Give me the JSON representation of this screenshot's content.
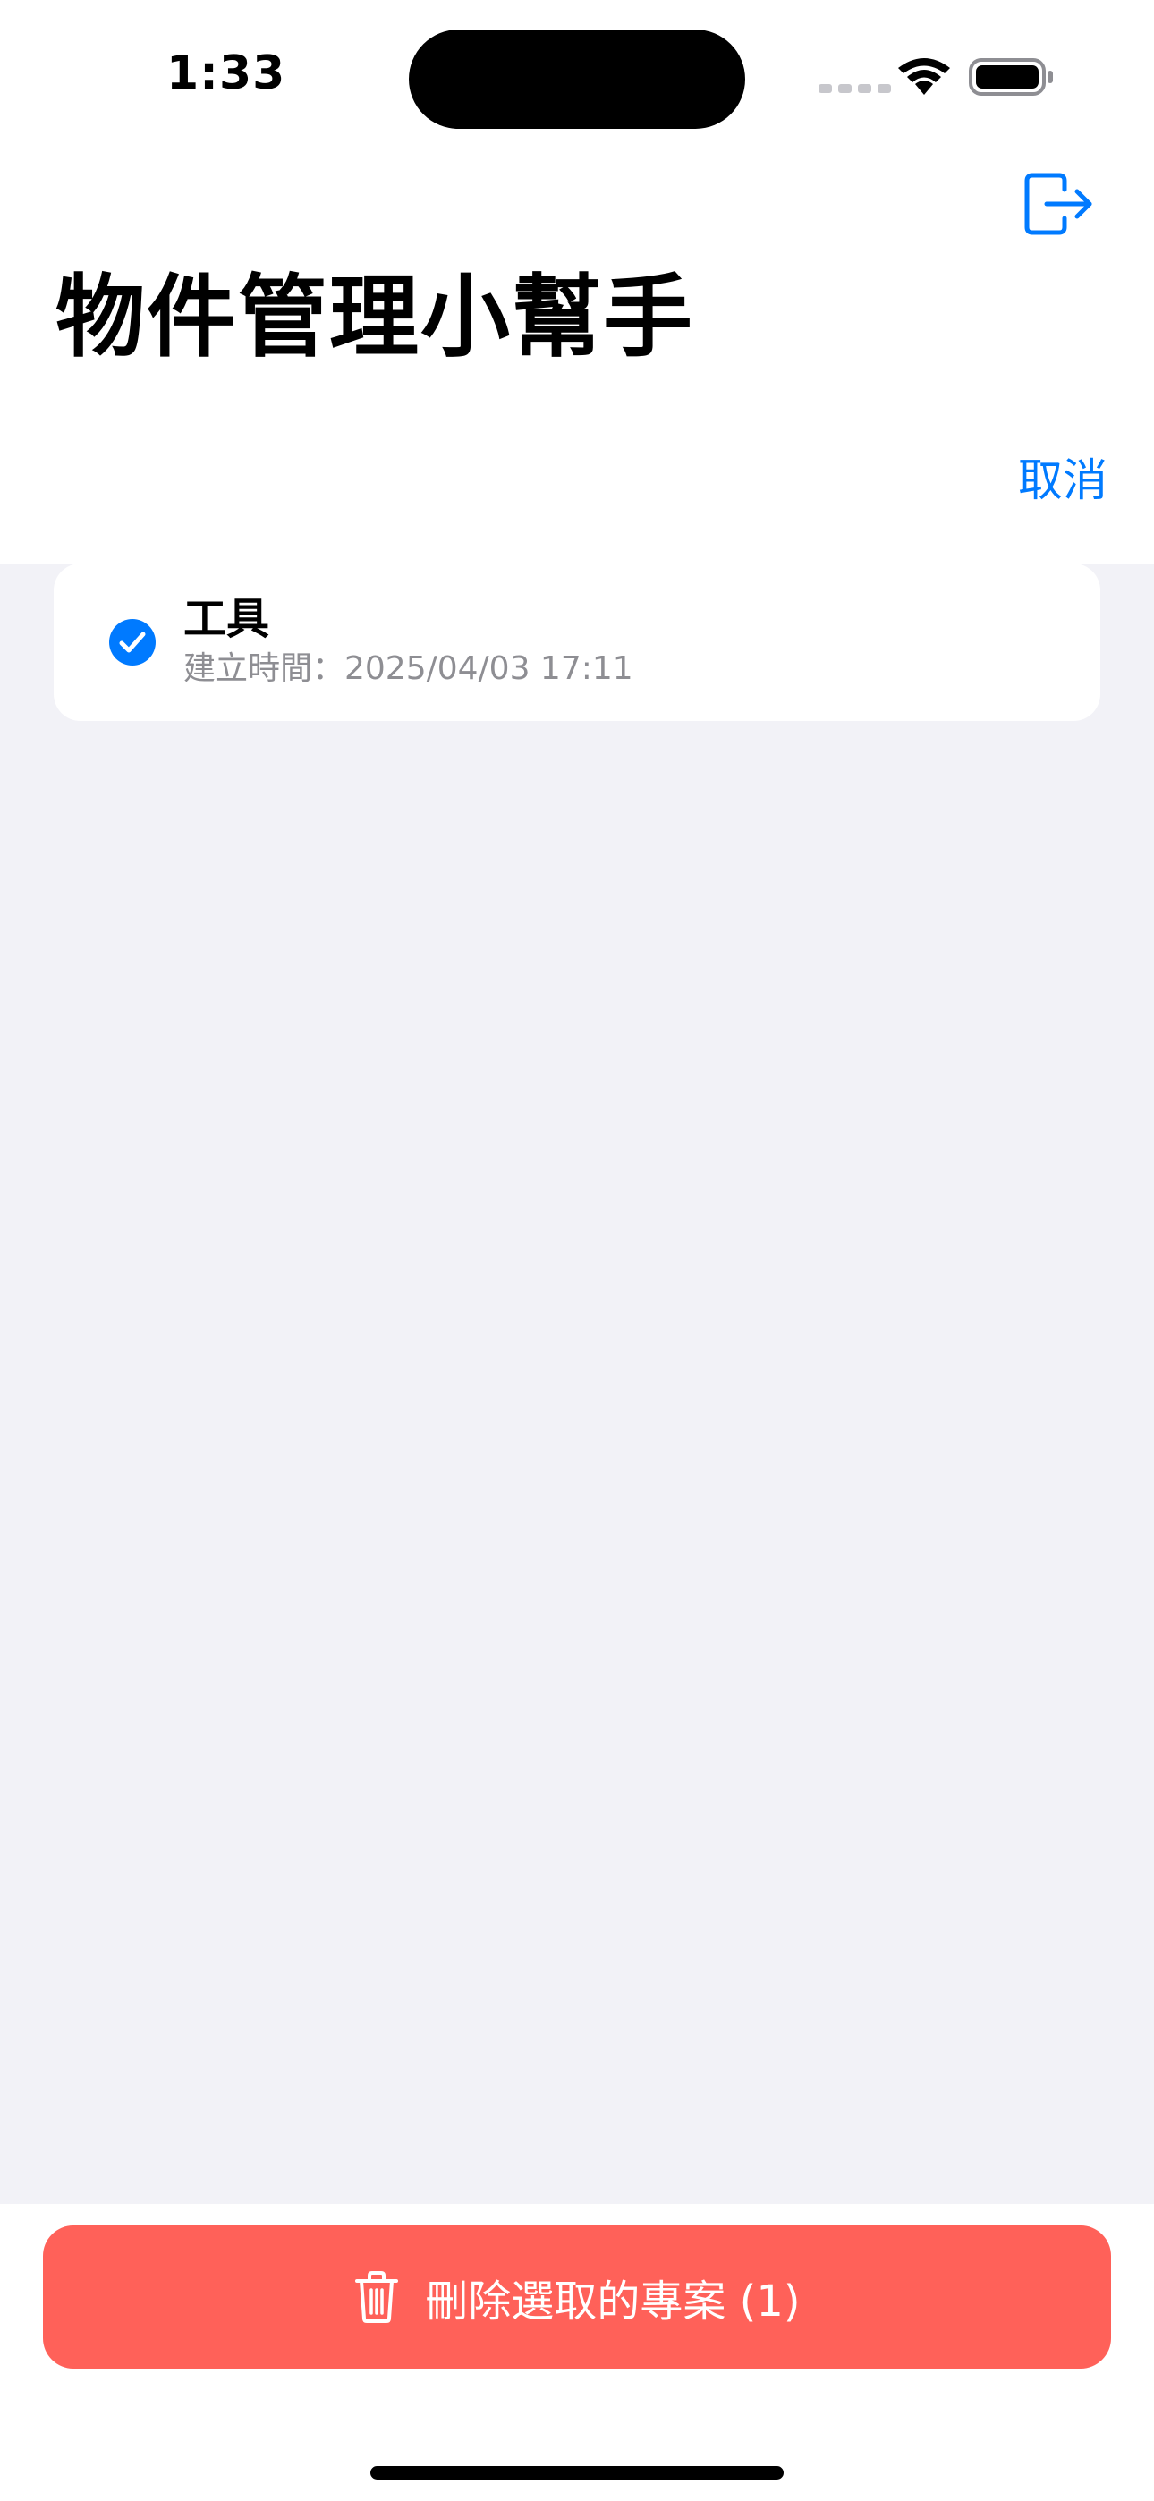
{
  "status_bar": {
    "time": "1:33"
  },
  "header": {
    "title": "物件管理小幫手",
    "cancel_label": "取消",
    "logout_icon": "logout-icon"
  },
  "list": {
    "items": [
      {
        "title": "工具",
        "subtitle": "建立時間：2025/04/03 17:11",
        "selected": true
      }
    ]
  },
  "footer": {
    "delete_label": "刪除選取的專案 (1)",
    "delete_icon": "trash-icon"
  },
  "colors": {
    "accent": "#007aff",
    "danger": "#ff6159",
    "background": "#f2f2f7"
  }
}
